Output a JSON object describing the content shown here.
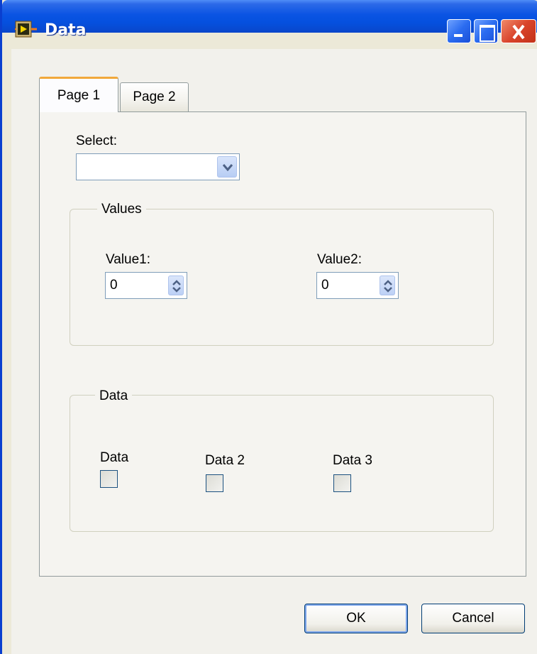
{
  "window": {
    "title": "Data",
    "buttons": [
      "minimize",
      "maximize",
      "close"
    ]
  },
  "tabs": [
    {
      "label": "Page 1",
      "active": true
    },
    {
      "label": "Page 2",
      "active": false
    }
  ],
  "page1": {
    "select": {
      "label": "Select:",
      "value": ""
    },
    "values_group": {
      "title": "Values",
      "value1": {
        "label": "Value1:",
        "value": "0"
      },
      "value2": {
        "label": "Value2:",
        "value": "0"
      }
    },
    "data_group": {
      "title": "Data",
      "checkboxes": [
        {
          "label": "Data",
          "checked": false
        },
        {
          "label": "Data 2",
          "checked": false
        },
        {
          "label": "Data 3",
          "checked": false
        }
      ]
    }
  },
  "buttons": {
    "ok": "OK",
    "cancel": "Cancel"
  },
  "colors": {
    "titlebar": "#0a54e3",
    "tab_accent": "#f1a83b",
    "close_button": "#d9442b"
  },
  "icons": {
    "app": "labview-run-icon",
    "select_arrow": "chevron-down-icon",
    "spinner": "spinner-arrows-icon"
  }
}
